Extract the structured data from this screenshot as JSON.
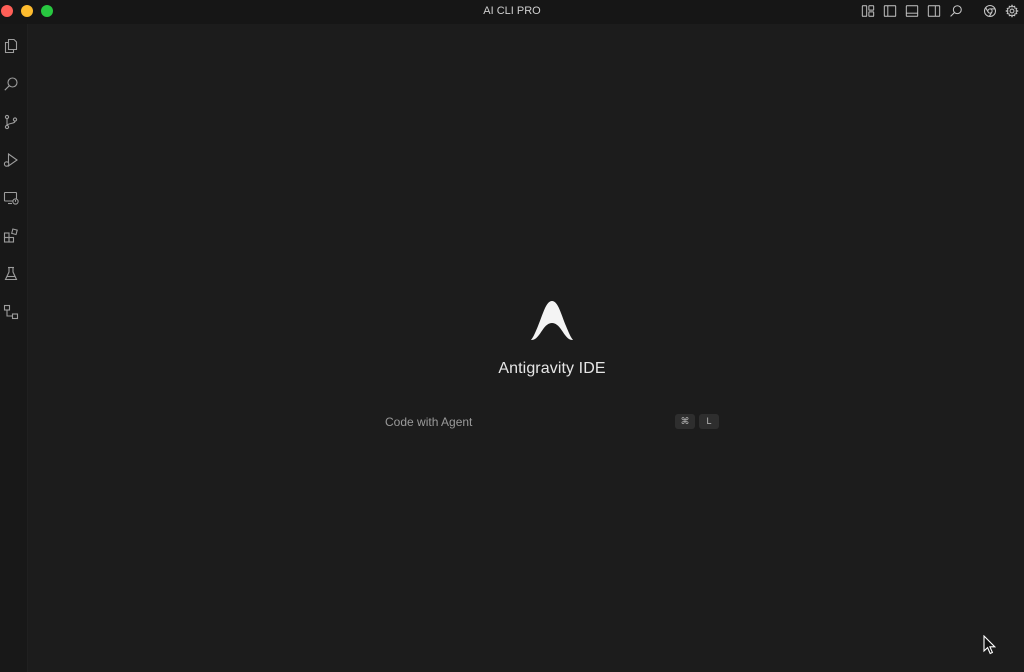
{
  "window": {
    "title": "AI CLI PRO"
  },
  "colors": {
    "close": "#ff5f57",
    "minimize": "#febc2e",
    "maximize": "#28c840",
    "background": "#1c1c1c"
  },
  "activity_bar": {
    "items": [
      {
        "name": "explorer",
        "icon": "files-icon"
      },
      {
        "name": "search",
        "icon": "search-icon"
      },
      {
        "name": "source-control",
        "icon": "source-control-icon"
      },
      {
        "name": "run-and-debug",
        "icon": "run-debug-icon"
      },
      {
        "name": "remote-explorer",
        "icon": "remote-explorer-icon"
      },
      {
        "name": "extensions",
        "icon": "extensions-icon"
      },
      {
        "name": "testing",
        "icon": "beaker-icon"
      },
      {
        "name": "agent-manager",
        "icon": "diagram-icon"
      }
    ]
  },
  "title_actions": [
    {
      "name": "customize-layout",
      "icon": "layout-icon"
    },
    {
      "name": "toggle-primary-sidebar",
      "icon": "sidebar-left-icon"
    },
    {
      "name": "toggle-panel",
      "icon": "panel-icon"
    },
    {
      "name": "toggle-secondary-sidebar",
      "icon": "sidebar-right-icon"
    },
    {
      "name": "search",
      "icon": "search-icon"
    },
    {
      "name": "browser",
      "icon": "chrome-icon"
    },
    {
      "name": "settings",
      "icon": "gear-icon"
    }
  ],
  "welcome": {
    "app_name": "Antigravity IDE",
    "shortcut_label": "Code with Agent",
    "shortcut_keys": [
      "⌘",
      "L"
    ]
  }
}
